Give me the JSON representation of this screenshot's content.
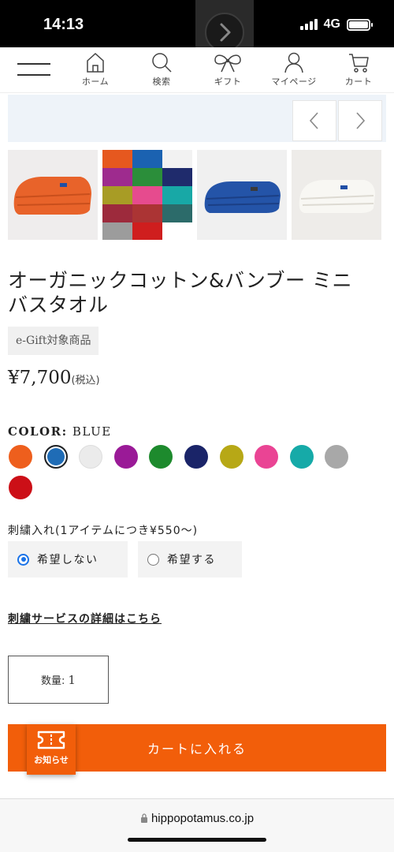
{
  "status": {
    "time": "14:13",
    "network": "4G"
  },
  "nav": {
    "items": [
      {
        "label": "ホーム"
      },
      {
        "label": "検索"
      },
      {
        "label": "ギフト"
      },
      {
        "label": "マイページ"
      },
      {
        "label": "カート"
      }
    ]
  },
  "product": {
    "title_line1": "オーガニックコットン&バンブー ミニ",
    "title_line2": "バスタオル",
    "egift": "e-Gift対象商品",
    "price": "¥7,700",
    "tax": "(税込)"
  },
  "color": {
    "label": "COLOR:",
    "selected": "BLUE",
    "swatches": [
      "#ee5f1d",
      "#1f6cb6",
      "#ebebeb",
      "#9a1a97",
      "#1d8a2d",
      "#1a2468",
      "#b7a816",
      "#ea4494",
      "#16aaa8",
      "#a8a8a8",
      "#cc0f17"
    ]
  },
  "embroidery": {
    "label": "刺繍入れ(1アイテムにつき¥550〜)",
    "option_no": "希望しない",
    "option_yes": "希望する",
    "link": "刺繍サービスの詳細はこちら"
  },
  "quantity": {
    "label": "数量:",
    "value": "1"
  },
  "cart": {
    "label": "カートに入れる",
    "notice": "お知らせ"
  },
  "browser": {
    "url": "hippopotamus.co.jp"
  }
}
